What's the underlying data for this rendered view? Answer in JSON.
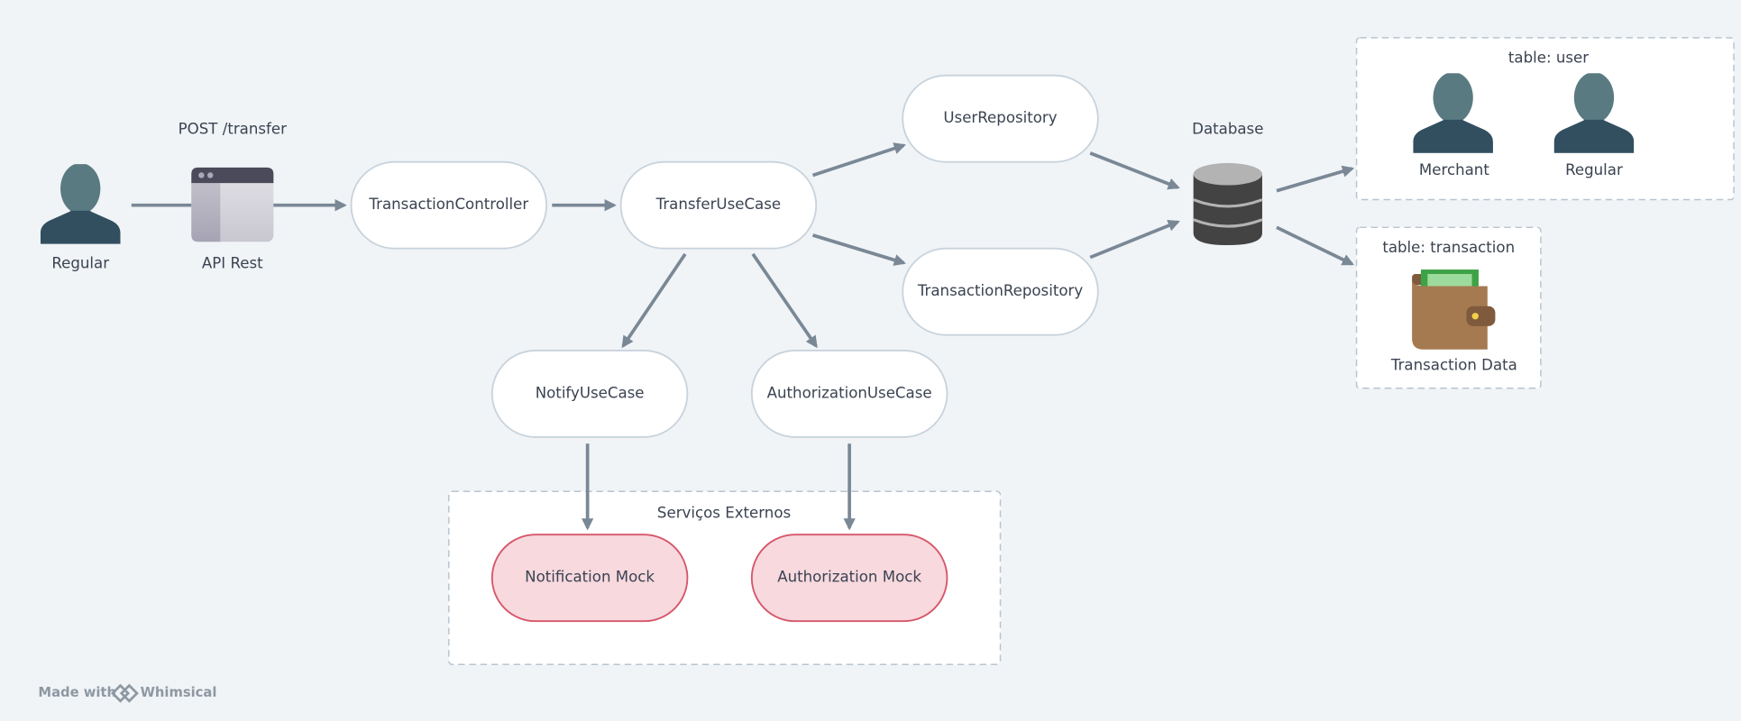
{
  "actor": {
    "label": "Regular",
    "icon": "user-icon"
  },
  "api": {
    "label": "API Rest",
    "endpoint": "POST /transfer",
    "icon": "browser-window-icon"
  },
  "nodes": {
    "controller": "TransactionController",
    "transfer": "TransferUseCase",
    "user_repo": "UserRepository",
    "tx_repo": "TransactionRepository",
    "notify": "NotifyUseCase",
    "authorization": "AuthorizationUseCase"
  },
  "external": {
    "title": "Serviços Externos",
    "notification_mock": "Notification Mock",
    "authorization_mock": "Authorization Mock"
  },
  "database": {
    "label": "Database",
    "icon": "database-icon"
  },
  "table_user": {
    "title": "table: user",
    "items": [
      "Merchant",
      "Regular"
    ]
  },
  "table_transaction": {
    "title": "table: transaction",
    "item": "Transaction Data",
    "icon": "wallet-icon"
  },
  "footer": {
    "made_with": "Made with",
    "brand": "Whimsical"
  },
  "colors": {
    "background": "#f0f4f7",
    "arrow": "#7a8896",
    "mock_fill": "#f7d9de",
    "mock_stroke": "#d6566a",
    "person_head": "#5a7a82",
    "person_body": "#324f60"
  }
}
